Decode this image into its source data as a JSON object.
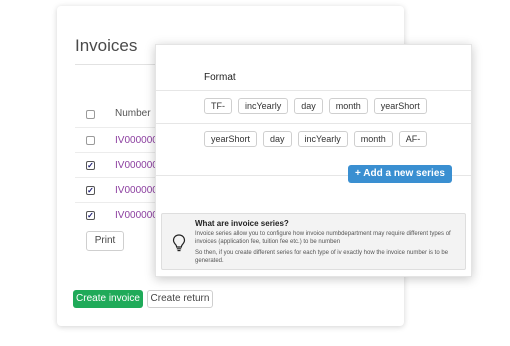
{
  "invoices_card": {
    "title": "Invoices",
    "column_header": "Number",
    "rows": [
      {
        "number": "IV000000",
        "checked": false
      },
      {
        "number": "IV000000",
        "checked": true
      },
      {
        "number": "IV000000",
        "checked": true
      },
      {
        "number": "IV000000",
        "checked": true
      }
    ],
    "print_label": "Print",
    "create_invoice_label": "Create invoice",
    "create_return_label": "Create return"
  },
  "series_card": {
    "format_label": "Format",
    "series": [
      [
        "TF-",
        "incYearly",
        "day",
        "month",
        "yearShort"
      ],
      [
        "yearShort",
        "day",
        "incYearly",
        "month",
        "AF-"
      ]
    ],
    "add_series_label": "+   Add a new series",
    "info": {
      "title": "What are invoice series?",
      "line1": "Invoice series allow you to configure how invoice numbdepartment may require different types of",
      "line2": "invoices (application fee, tuition fee etc.) to be numben",
      "line3": "So then, if you create different series for each type of iv exactly how the invoice number is to be",
      "line4": "generated."
    }
  },
  "colors": {
    "primary_green": "#1faa59",
    "primary_blue": "#3a8fd1",
    "link_purple": "#8c3fa0"
  }
}
